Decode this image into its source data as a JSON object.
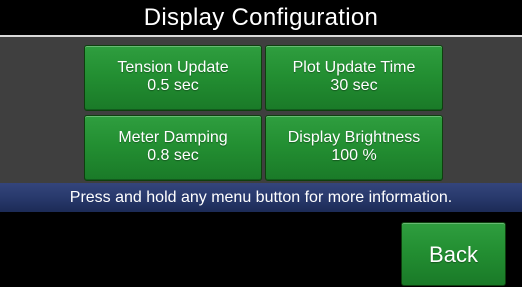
{
  "header": {
    "title": "Display Configuration"
  },
  "menu": {
    "buttons": [
      {
        "label": "Tension Update",
        "value": "0.5 sec"
      },
      {
        "label": "Plot Update Time",
        "value": "30 sec"
      },
      {
        "label": "Meter Damping",
        "value": "0.8 sec"
      },
      {
        "label": "Display Brightness",
        "value": "100 %"
      }
    ]
  },
  "info_bar": {
    "message": "Press and hold any menu button for more information."
  },
  "footer": {
    "back_label": "Back"
  },
  "colors": {
    "button_green": "#238f32",
    "info_bar_blue": "#27386a",
    "panel_gray": "#3f3f3f",
    "background": "#000000",
    "text": "#ffffff"
  }
}
